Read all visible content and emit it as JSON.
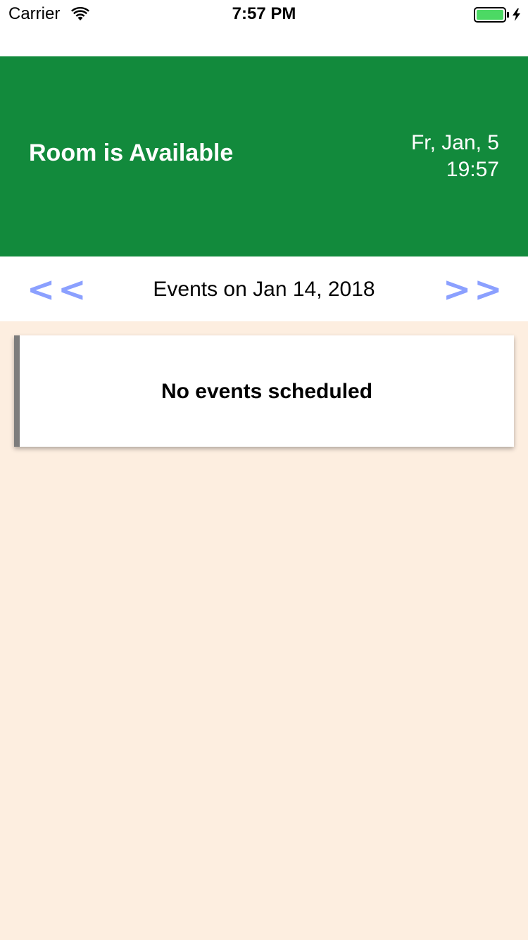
{
  "status_bar": {
    "carrier": "Carrier",
    "time": "7:57 PM",
    "battery_icon": "battery-charging-icon",
    "wifi_icon": "wifi-icon"
  },
  "header": {
    "room_status": "Room is Available",
    "date_line": "Fr, Jan, 5",
    "time_line": "19:57",
    "background_color": "#128a3c"
  },
  "navigation": {
    "prev_label": "<<",
    "next_label": ">>",
    "title": "Events on Jan 14, 2018",
    "arrow_color": "#8ba0ff"
  },
  "events": {
    "empty_message": "No events scheduled"
  }
}
